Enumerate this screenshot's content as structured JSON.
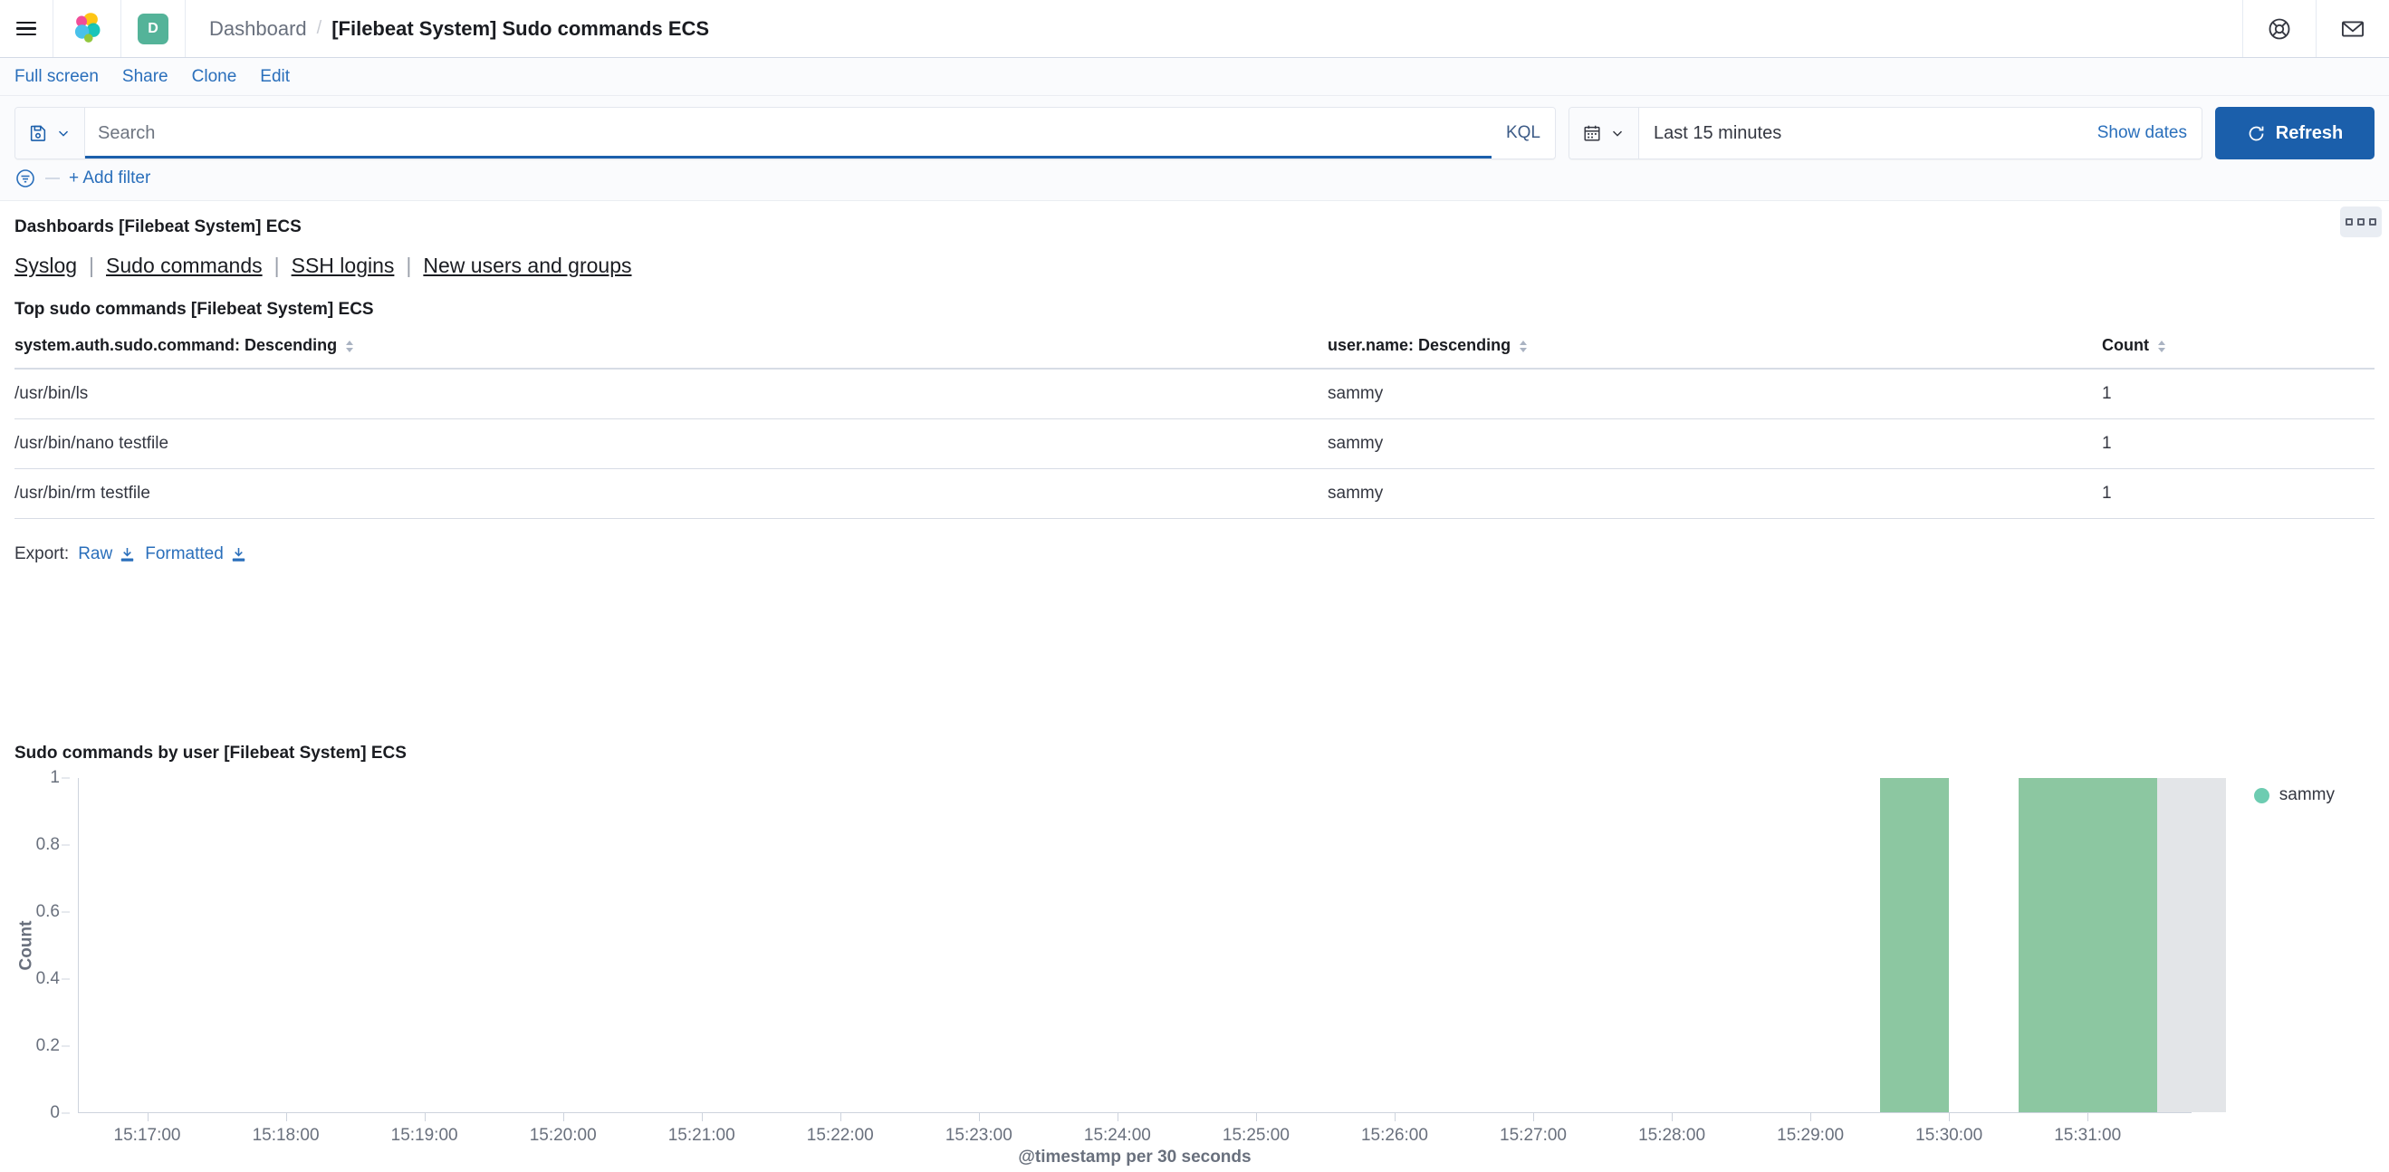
{
  "header": {
    "menu_icon": "hamburger-menu-icon",
    "logo_icon": "elastic-logo-icon",
    "space_avatar_letter": "D",
    "breadcrumb_root": "Dashboard",
    "breadcrumb_separator": "/",
    "breadcrumb_current": "[Filebeat System] Sudo commands ECS",
    "help_icon": "help-lifering-icon",
    "news_icon": "mail-news-icon"
  },
  "actionbar": {
    "full_screen": "Full screen",
    "share": "Share",
    "clone": "Clone",
    "edit": "Edit"
  },
  "query": {
    "saved_query_icon": "saved-query-disk-icon",
    "chevron_icon": "chevron-down-icon",
    "placeholder": "Search",
    "value": "",
    "language": "KQL"
  },
  "datepicker": {
    "calendar_icon": "calendar-icon",
    "chevron_icon": "chevron-down-icon",
    "value": "Last 15 minutes",
    "show_dates": "Show dates"
  },
  "refresh": {
    "icon": "refresh-icon",
    "label": "Refresh"
  },
  "filters": {
    "filter_icon": "filter-options-icon",
    "add_filter": "+ Add filter"
  },
  "markdown_panel": {
    "title": "Dashboards [Filebeat System] ECS",
    "links": [
      "Syslog",
      "Sudo commands",
      "SSH logins",
      "New users and groups"
    ],
    "separator": "|"
  },
  "table_panel": {
    "title": "Top sudo commands [Filebeat System] ECS",
    "columns": [
      "system.auth.sudo.command: Descending",
      "user.name: Descending",
      "Count"
    ],
    "rows": [
      [
        "/usr/bin/ls",
        "sammy",
        "1"
      ],
      [
        "/usr/bin/nano testfile",
        "sammy",
        "1"
      ],
      [
        "/usr/bin/rm testfile",
        "sammy",
        "1"
      ]
    ],
    "export_label": "Export:",
    "export_raw": "Raw",
    "export_formatted": "Formatted",
    "download_icon": "download-icon",
    "options_icon": "panel-options-icon"
  },
  "chart_panel": {
    "title": "Sudo commands by user [Filebeat System] ECS"
  },
  "chart_data": {
    "type": "bar",
    "title": "Sudo commands by user [Filebeat System] ECS",
    "xlabel": "@timestamp per 30 seconds",
    "ylabel": "Count",
    "ylim": [
      0,
      1
    ],
    "yticks": [
      "0",
      "0.2",
      "0.4",
      "0.6",
      "0.8",
      "1"
    ],
    "ytick_values": [
      0,
      0.2,
      0.4,
      0.6,
      0.8,
      1
    ],
    "xticks": [
      "15:17:00",
      "15:18:00",
      "15:19:00",
      "15:20:00",
      "15:21:00",
      "15:22:00",
      "15:23:00",
      "15:24:00",
      "15:25:00",
      "15:26:00",
      "15:27:00",
      "15:28:00",
      "15:29:00",
      "15:30:00",
      "15:31:00"
    ],
    "xlim": [
      "15:16:30",
      "15:31:45"
    ],
    "grid": false,
    "legend_position": "right",
    "series": [
      {
        "name": "sammy",
        "color": "#8cc7a1",
        "categories": [
          "15:29:30",
          "15:30:30",
          "15:31:00"
        ],
        "values": [
          1,
          1,
          1
        ]
      }
    ],
    "legend": [
      "sammy"
    ]
  }
}
